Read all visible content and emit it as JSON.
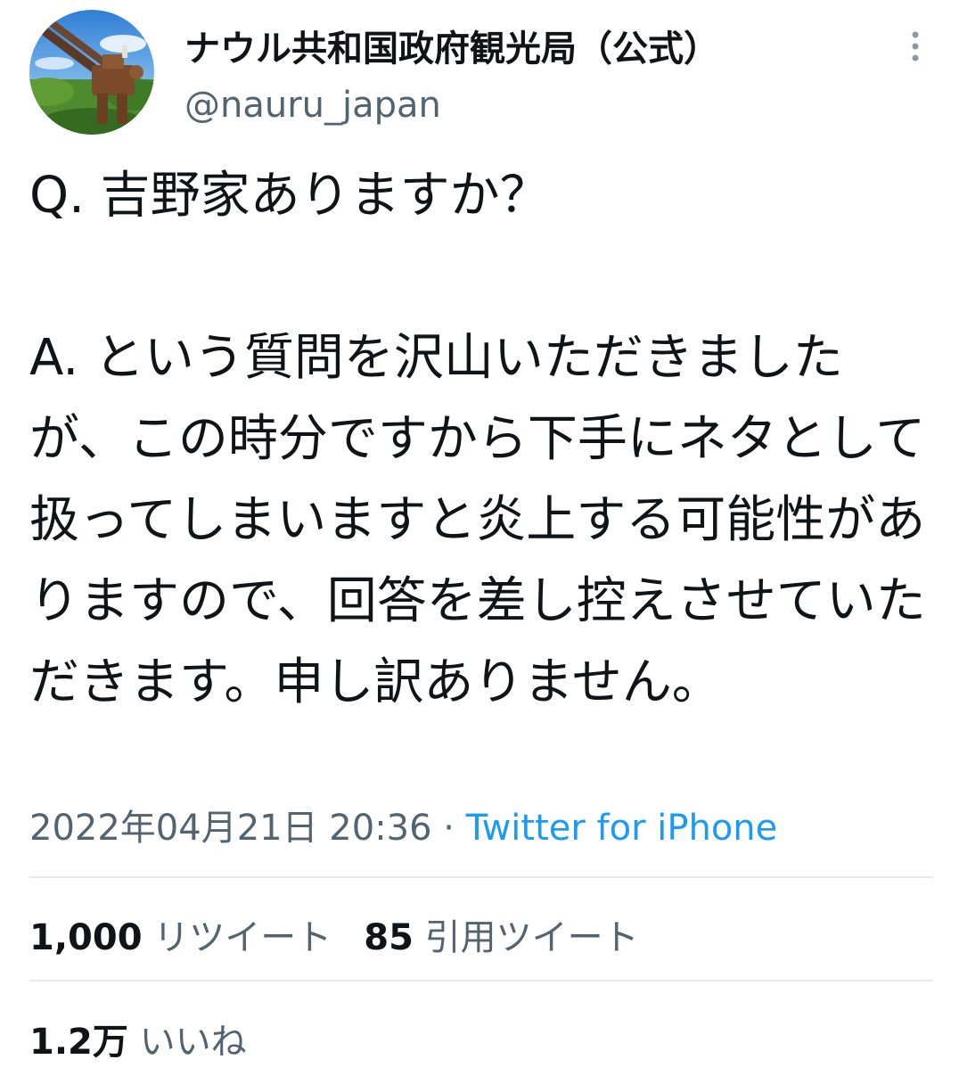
{
  "account": {
    "display_name": "ナウル共和国政府観光局（公式）",
    "handle": "@nauru_japan",
    "avatar": "avatar-rusted-anti-aircraft-gun-photo"
  },
  "tweet": {
    "text": "Q. 吉野家ありますか？\n\nA. という質問を沢山いただきましたが、この時分ですから下手にネタとして扱ってしまいますと炎上する可能性がありますので、回答を差し控えさせていただきます。申し訳ありません。",
    "timestamp": "2022年04月21日 20:36",
    "separator": " · ",
    "source": "Twitter for iPhone"
  },
  "stats": {
    "retweets": {
      "count": "1,000",
      "label": "リツイート"
    },
    "quotes": {
      "count": "85",
      "label": "引用ツイート"
    },
    "likes": {
      "count": "1.2万",
      "label": "いいね"
    }
  },
  "icons": {
    "more": "more-vertical-icon"
  },
  "colors": {
    "text": "#0f1419",
    "secondary": "#536471",
    "link": "#1d9bf0",
    "divider": "#e7e9ea"
  }
}
